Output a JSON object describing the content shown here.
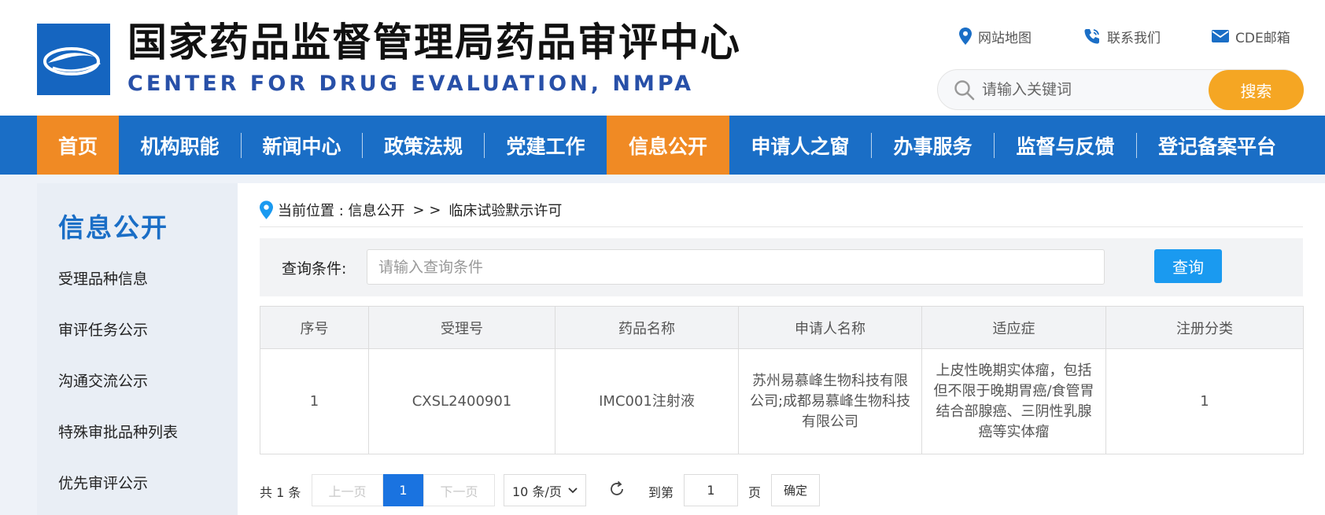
{
  "header": {
    "title_cn": "国家药品监督管理局药品审评中心",
    "title_en": "CENTER FOR DRUG EVALUATION, NMPA",
    "links": {
      "site_map": "网站地图",
      "contact": "联系我们",
      "mail": "CDE邮箱"
    },
    "search": {
      "placeholder": "请输入关键词",
      "button": "搜索"
    }
  },
  "nav": {
    "items": [
      {
        "label": "首页",
        "active": true
      },
      {
        "label": "机构职能",
        "active": false
      },
      {
        "label": "新闻中心",
        "active": false
      },
      {
        "label": "政策法规",
        "active": false
      },
      {
        "label": "党建工作",
        "active": false
      },
      {
        "label": "信息公开",
        "active": true
      },
      {
        "label": "申请人之窗",
        "active": false
      },
      {
        "label": "办事服务",
        "active": false
      },
      {
        "label": "监督与反馈",
        "active": false
      },
      {
        "label": "登记备案平台",
        "active": false
      }
    ]
  },
  "sidebar": {
    "title": "信息公开",
    "items": [
      {
        "label": "受理品种信息"
      },
      {
        "label": "审评任务公示"
      },
      {
        "label": "沟通交流公示"
      },
      {
        "label": "特殊审批品种列表"
      },
      {
        "label": "优先审评公示"
      }
    ]
  },
  "breadcrumb": {
    "prefix": "当前位置 : 信息公开",
    "separator": "> >",
    "current": "临床试验默示许可"
  },
  "query": {
    "label": "查询条件:",
    "placeholder": "请输入查询条件",
    "button": "查询"
  },
  "table": {
    "columns": [
      "序号",
      "受理号",
      "药品名称",
      "申请人名称",
      "适应症",
      "注册分类"
    ],
    "rows": [
      {
        "no": "1",
        "accept_no": "CXSL2400901",
        "drug": "IMC001注射液",
        "applicant": "苏州易慕峰生物科技有限公司;成都易慕峰生物科技有限公司",
        "indication": "上皮性晚期实体瘤，包括但不限于晚期胃癌/食管胃结合部腺癌、三阴性乳腺癌等实体瘤",
        "category": "1"
      }
    ]
  },
  "pagination": {
    "total": "共 1 条",
    "prev": "上一页",
    "current": "1",
    "next": "下一页",
    "page_size": "10 条/页",
    "goto": "到第",
    "jump_value": "1",
    "page_unit": "页",
    "confirm": "确定"
  },
  "colors": {
    "nav_bg": "#1a6ec6",
    "nav_active": "#f08a24",
    "search_btn": "#f5a623",
    "query_btn": "#1a9af0",
    "page_current": "#1a73e0",
    "title_en": "#2850a8"
  },
  "icons": {
    "logo": "cde-logo",
    "site_map": "location-pin-icon",
    "contact": "phone-icon",
    "mail": "envelope-icon",
    "search": "search-icon",
    "breadcrumb": "location-pin-icon",
    "page_size": "chevron-down-icon",
    "refresh": "refresh-icon"
  }
}
